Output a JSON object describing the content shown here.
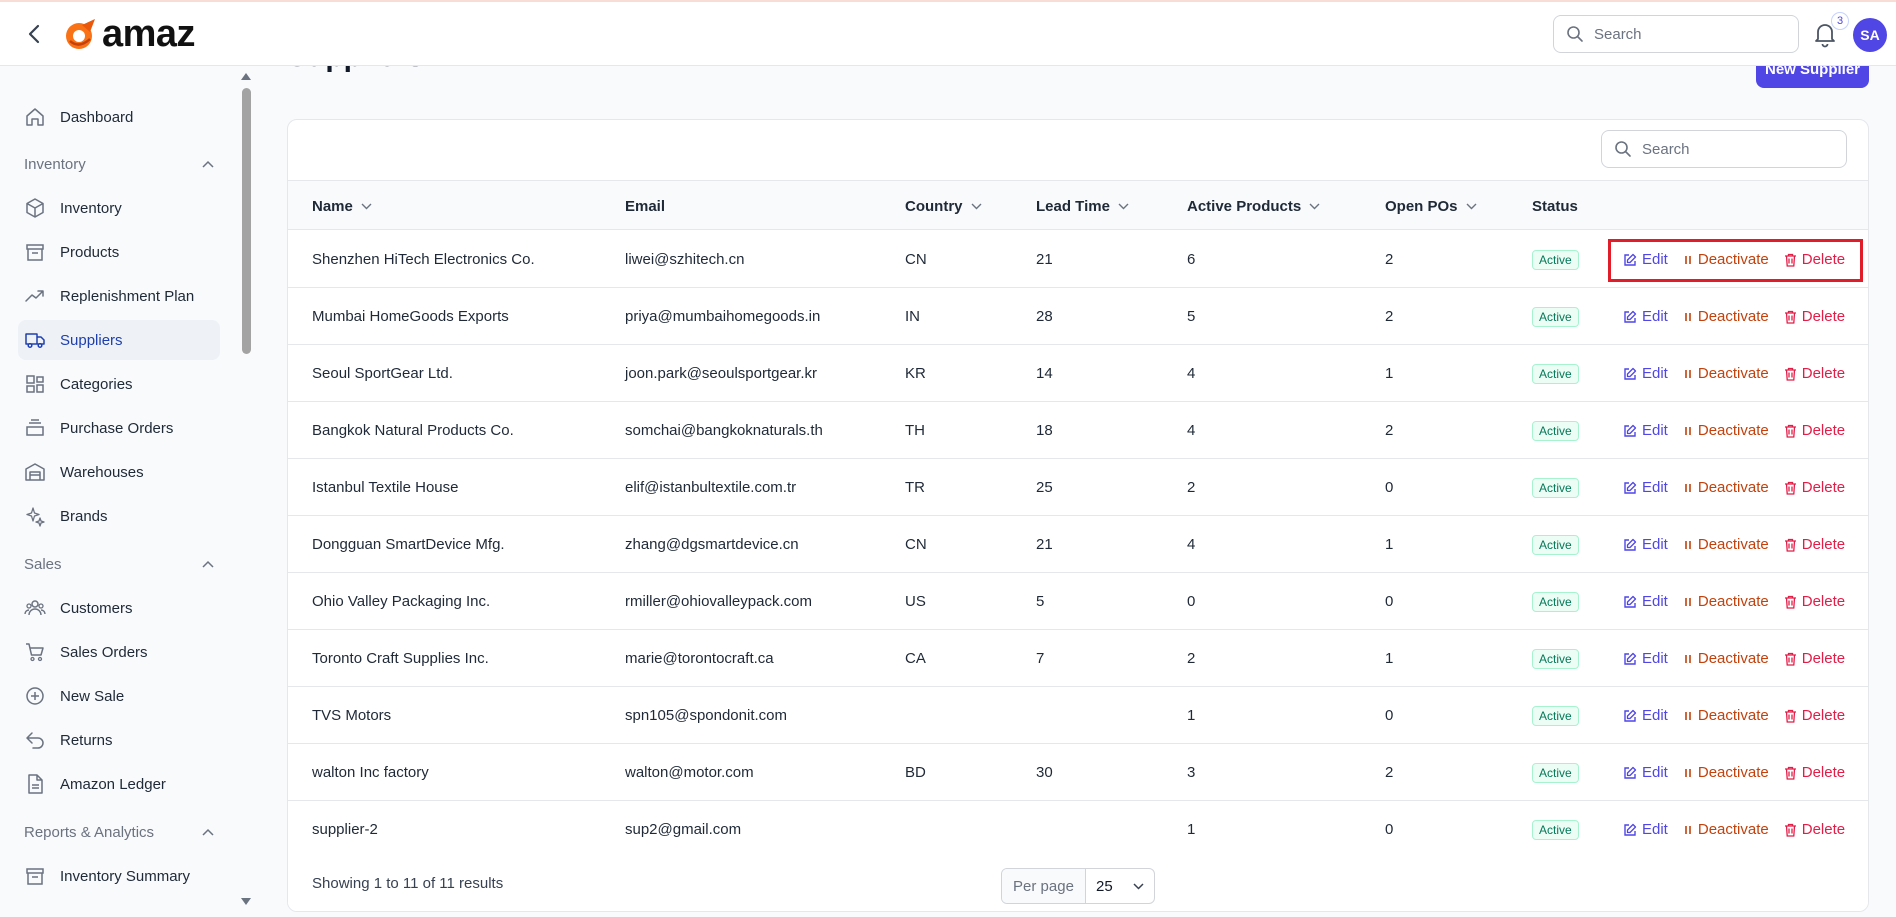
{
  "header": {
    "brand": "amaz",
    "search_placeholder": "Search",
    "notification_count": "3",
    "avatar_initials": "SA"
  },
  "sidebar": {
    "dashboard": "Dashboard",
    "inventory_section": "Inventory",
    "inventory_items": [
      "Inventory",
      "Products",
      "Replenishment Plan",
      "Suppliers",
      "Categories",
      "Purchase Orders",
      "Warehouses",
      "Brands"
    ],
    "sales_section": "Sales",
    "sales_items": [
      "Customers",
      "Sales Orders",
      "New Sale",
      "Returns",
      "Amazon Ledger"
    ],
    "reports_section": "Reports & Analytics",
    "reports_items": [
      "Inventory Summary"
    ]
  },
  "page": {
    "title": "Suppliers",
    "new_button": "New Supplier",
    "table_search_placeholder": "Search"
  },
  "table": {
    "columns": [
      "Name",
      "Email",
      "Country",
      "Lead Time",
      "Active Products",
      "Open POs",
      "Status"
    ],
    "action_labels": {
      "edit": "Edit",
      "deactivate": "Deactivate",
      "delete": "Delete"
    },
    "rows": [
      {
        "name": "Shenzhen HiTech Electronics Co.",
        "email": "liwei@szhitech.cn",
        "country": "CN",
        "lead_time": "21",
        "active_products": "6",
        "open_pos": "2",
        "status": "Active"
      },
      {
        "name": "Mumbai HomeGoods Exports",
        "email": "priya@mumbaihomegoods.in",
        "country": "IN",
        "lead_time": "28",
        "active_products": "5",
        "open_pos": "2",
        "status": "Active"
      },
      {
        "name": "Seoul SportGear Ltd.",
        "email": "joon.park@seoulsportgear.kr",
        "country": "KR",
        "lead_time": "14",
        "active_products": "4",
        "open_pos": "1",
        "status": "Active"
      },
      {
        "name": "Bangkok Natural Products Co.",
        "email": "somchai@bangkoknaturals.th",
        "country": "TH",
        "lead_time": "18",
        "active_products": "4",
        "open_pos": "2",
        "status": "Active"
      },
      {
        "name": "Istanbul Textile House",
        "email": "elif@istanbultextile.com.tr",
        "country": "TR",
        "lead_time": "25",
        "active_products": "2",
        "open_pos": "0",
        "status": "Active"
      },
      {
        "name": "Dongguan SmartDevice Mfg.",
        "email": "zhang@dgsmartdevice.cn",
        "country": "CN",
        "lead_time": "21",
        "active_products": "4",
        "open_pos": "1",
        "status": "Active"
      },
      {
        "name": "Ohio Valley Packaging Inc.",
        "email": "rmiller@ohiovalleypack.com",
        "country": "US",
        "lead_time": "5",
        "active_products": "0",
        "open_pos": "0",
        "status": "Active"
      },
      {
        "name": "Toronto Craft Supplies Inc.",
        "email": "marie@torontocraft.ca",
        "country": "CA",
        "lead_time": "7",
        "active_products": "2",
        "open_pos": "1",
        "status": "Active"
      },
      {
        "name": "TVS Motors",
        "email": "spn105@spondonit.com",
        "country": "",
        "lead_time": "",
        "active_products": "1",
        "open_pos": "0",
        "status": "Active"
      },
      {
        "name": "walton Inc factory",
        "email": "walton@motor.com",
        "country": "BD",
        "lead_time": "30",
        "active_products": "3",
        "open_pos": "2",
        "status": "Active"
      },
      {
        "name": "supplier-2",
        "email": "sup2@gmail.com",
        "country": "",
        "lead_time": "",
        "active_products": "1",
        "open_pos": "0",
        "status": "Active"
      }
    ]
  },
  "footer": {
    "showing": "Showing 1 to 11 of 11 results",
    "per_page_label": "Per page",
    "per_page_value": "25"
  },
  "colors": {
    "accent": "#4f46e5",
    "deactivate": "#c2410c",
    "delete": "#e11d48",
    "active_badge": "#047857",
    "highlight": "#e11d2a"
  }
}
